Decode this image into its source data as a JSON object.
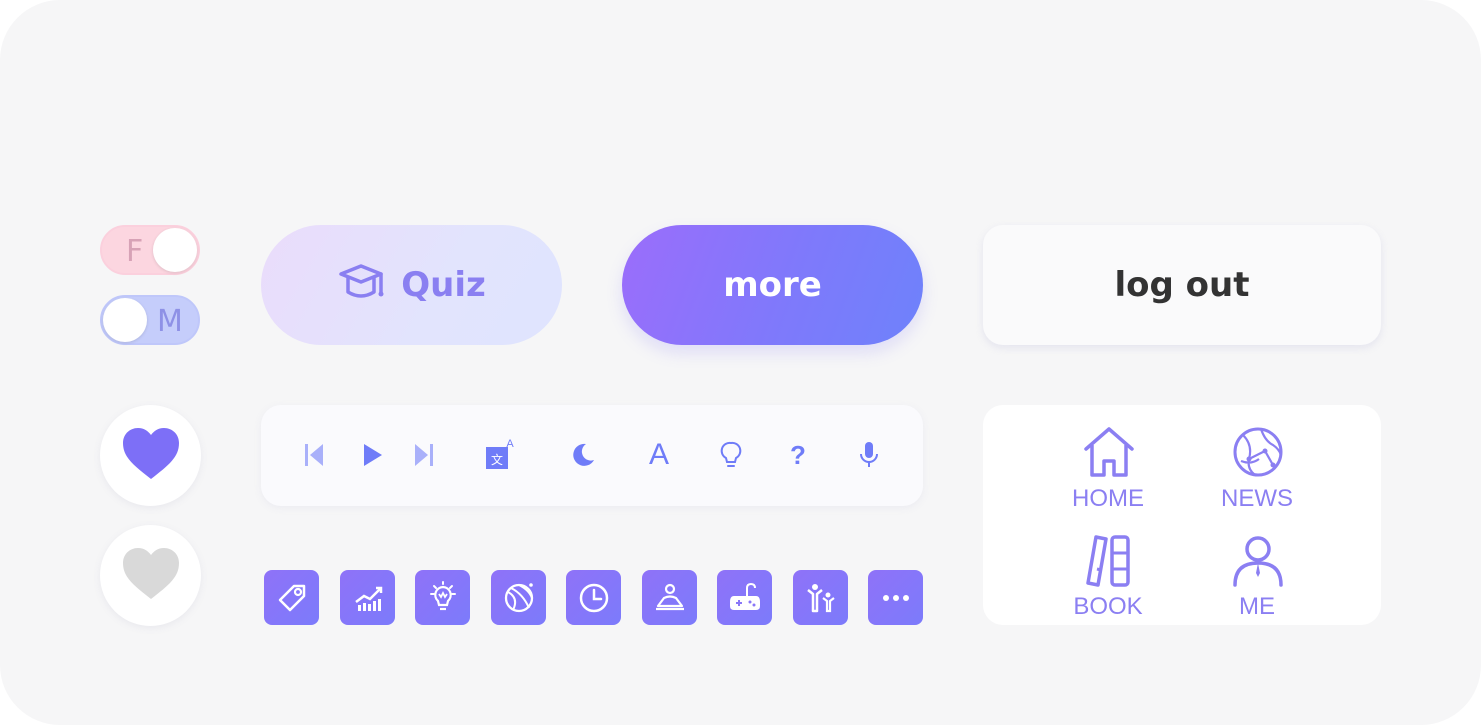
{
  "toggles": {
    "female": {
      "letter": "F",
      "state": "on"
    },
    "male": {
      "letter": "M",
      "state": "off"
    }
  },
  "buttons": {
    "quiz": {
      "label": "Quiz",
      "icon": "graduation-cap-icon"
    },
    "more": {
      "label": "more"
    },
    "logout": {
      "label": "log out"
    }
  },
  "hearts": [
    {
      "icon": "heart-icon",
      "state": "liked",
      "color": "#7d6ff7"
    },
    {
      "icon": "heart-icon",
      "state": "not-liked",
      "color": "#d9d9d9"
    }
  ],
  "toolbar": {
    "icons": [
      "skip-back-icon",
      "play-icon",
      "skip-forward-icon",
      "translate-icon",
      "moon-icon",
      "font-icon",
      "lightbulb-icon",
      "help-icon",
      "microphone-icon"
    ],
    "translate_glyphs": {
      "a": "A",
      "zh": "文"
    },
    "font_glyph": "A",
    "help_glyph": "?"
  },
  "app_icons": [
    "tag-icon",
    "chart-icon",
    "idea-icon",
    "basketball-icon",
    "clock-icon",
    "meditation-icon",
    "gamepad-icon",
    "family-icon",
    "more-dots-icon"
  ],
  "nav": {
    "items": [
      {
        "label": "HOME",
        "icon": "home-icon"
      },
      {
        "label": "NEWS",
        "icon": "globe-icon"
      },
      {
        "label": "BOOK",
        "icon": "books-icon"
      },
      {
        "label": "ME",
        "icon": "user-icon"
      }
    ]
  },
  "colors": {
    "accent": "#7d6ff7",
    "accent_light": "#8b7ff2",
    "background": "#f6f6f7",
    "toggle_pink": "#fcd6e0",
    "toggle_blue": "#c5cdfb",
    "text_dark": "#333333"
  }
}
